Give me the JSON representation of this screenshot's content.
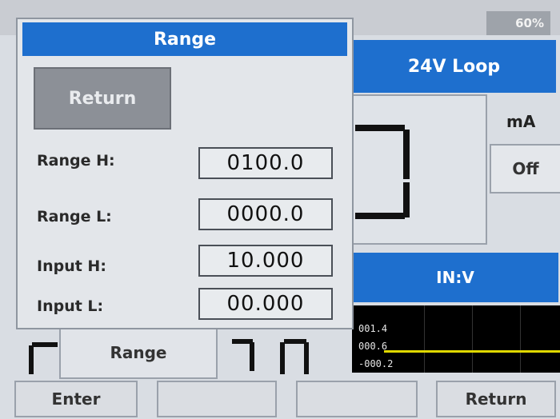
{
  "status": {
    "battery": "60%"
  },
  "main": {
    "loop_button": "24V Loop",
    "unit": "mA",
    "output_state": "Off",
    "input_mode": "IN:V",
    "trend": {
      "y_labels": [
        "001.4",
        "000.6",
        "-000.2"
      ]
    },
    "range_tab": "Range"
  },
  "softkeys": [
    "Enter",
    "",
    "",
    "Return"
  ],
  "dialog": {
    "title": "Range",
    "return_label": "Return",
    "rows": [
      {
        "label": "Range H:",
        "value": "0100.0"
      },
      {
        "label": "Range L:",
        "value": "0000.0"
      },
      {
        "label": "Input H:",
        "value": "10.000"
      },
      {
        "label": "Input L:",
        "value": "00.000"
      }
    ]
  },
  "colors": {
    "accent": "#1e6fce",
    "trend_line": "#e0d800"
  }
}
